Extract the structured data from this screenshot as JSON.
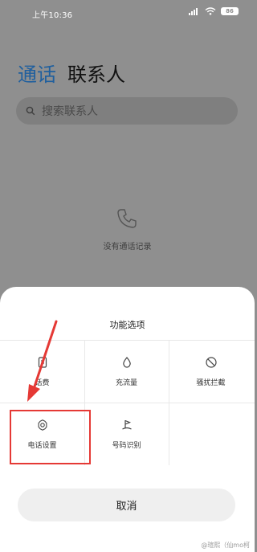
{
  "status_bar": {
    "time": "上午10:36",
    "battery": "86"
  },
  "tabs": [
    {
      "label": "通话",
      "active": true
    },
    {
      "label": "联系人",
      "active": false
    }
  ],
  "search": {
    "placeholder": "搜索联系人"
  },
  "empty_state": {
    "text": "没有通话记录"
  },
  "sheet": {
    "title": "功能选项",
    "options": [
      {
        "label": "话费",
        "icon": "phone-bill-icon"
      },
      {
        "label": "充流量",
        "icon": "water-drop-icon"
      },
      {
        "label": "骚扰拦截",
        "icon": "block-icon"
      },
      {
        "label": "电话设置",
        "icon": "gear-icon"
      },
      {
        "label": "号码识别",
        "icon": "flag-icon"
      }
    ],
    "cancel": "取消"
  },
  "watermark": "@瑄熙（仙mo柯"
}
